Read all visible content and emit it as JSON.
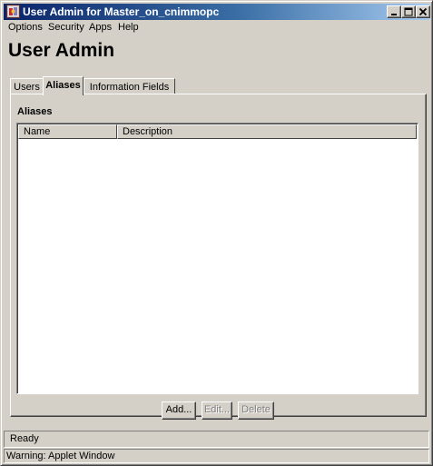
{
  "window": {
    "title": "User Admin for Master_on_cnimmopc",
    "controls": {
      "minimize_icon": "minimize-icon",
      "maximize_icon": "maximize-icon",
      "close_icon": "close-icon"
    }
  },
  "menu": {
    "items": [
      "Options",
      "Security",
      "Apps",
      "Help"
    ]
  },
  "page_title": "User Admin",
  "tabs": [
    {
      "label": "Users",
      "active": false
    },
    {
      "label": "Aliases",
      "active": true
    },
    {
      "label": "Information Fields",
      "active": false
    }
  ],
  "panel": {
    "section_label": "Aliases",
    "table": {
      "columns": [
        "Name",
        "Description"
      ],
      "rows": []
    },
    "buttons": [
      {
        "label": "Add...",
        "enabled": true
      },
      {
        "label": "Edit...",
        "enabled": false
      },
      {
        "label": "Delete",
        "enabled": false
      }
    ]
  },
  "status": {
    "text": "Ready",
    "warning": "Warning: Applet Window"
  }
}
